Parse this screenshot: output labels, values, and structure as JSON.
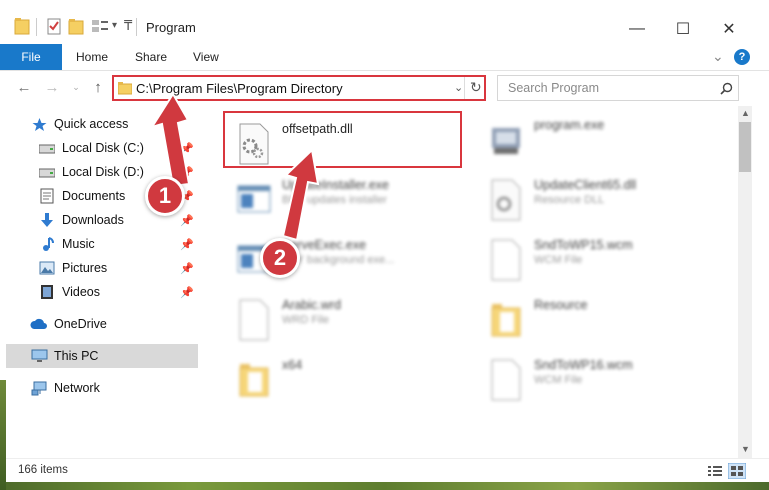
{
  "window": {
    "title": "Program",
    "minimize_label": "—",
    "maximize_label": "☐",
    "close_label": "✕"
  },
  "ribbon": {
    "tabs": [
      "File",
      "Home",
      "Share",
      "View"
    ],
    "expand_label": "⌄",
    "help_label": "?"
  },
  "address": {
    "path": "C:\\Program Files\\Program Directory"
  },
  "search": {
    "placeholder": "Search Program"
  },
  "sidebar": {
    "items": [
      {
        "label": "Quick access",
        "icon": "star-icon"
      },
      {
        "label": "Local Disk (C:)",
        "icon": "drive-icon",
        "pinned": true
      },
      {
        "label": "Local Disk (D:)",
        "icon": "drive-icon",
        "pinned": true
      },
      {
        "label": "Documents",
        "icon": "documents-icon",
        "pinned": true
      },
      {
        "label": "Downloads",
        "icon": "download-icon",
        "pinned": true
      },
      {
        "label": "Music",
        "icon": "music-icon",
        "pinned": true
      },
      {
        "label": "Pictures",
        "icon": "pictures-icon",
        "pinned": true
      },
      {
        "label": "Videos",
        "icon": "videos-icon",
        "pinned": true
      },
      {
        "label": "OneDrive",
        "icon": "cloud-icon"
      },
      {
        "label": "This PC",
        "icon": "computer-icon",
        "selected": true
      },
      {
        "label": "Network",
        "icon": "network-icon"
      }
    ]
  },
  "files": [
    {
      "name": "offsetpath.dll",
      "type": "",
      "icon": "dll-gear-icon",
      "highlighted": true
    },
    {
      "name": "program.exe",
      "type": "",
      "icon": "exe-icon"
    },
    {
      "name": "UpdateInstaller.exe",
      "type": "BBY updates installer",
      "icon": "exe-window-icon"
    },
    {
      "name": "UpdateClient65.dll",
      "type": "Resource DLL",
      "icon": "dll-gear-icon"
    },
    {
      "name": "ServeExec.exe",
      "type": "BBY background exe...",
      "icon": "exe-window-icon"
    },
    {
      "name": "SndToWP15.wcm",
      "type": "WCM File",
      "icon": "file-icon"
    },
    {
      "name": "Arabic.wrd",
      "type": "WRD File",
      "icon": "file-icon"
    },
    {
      "name": "Resource",
      "type": "",
      "icon": "folder-icon"
    },
    {
      "name": "x64",
      "type": "",
      "icon": "folder-icon"
    },
    {
      "name": "SndToWP16.wcm",
      "type": "WCM File",
      "icon": "file-icon"
    }
  ],
  "status": {
    "item_count": "166 items"
  },
  "annotations": {
    "step1": "1",
    "step2": "2",
    "color": "#d0393f"
  }
}
